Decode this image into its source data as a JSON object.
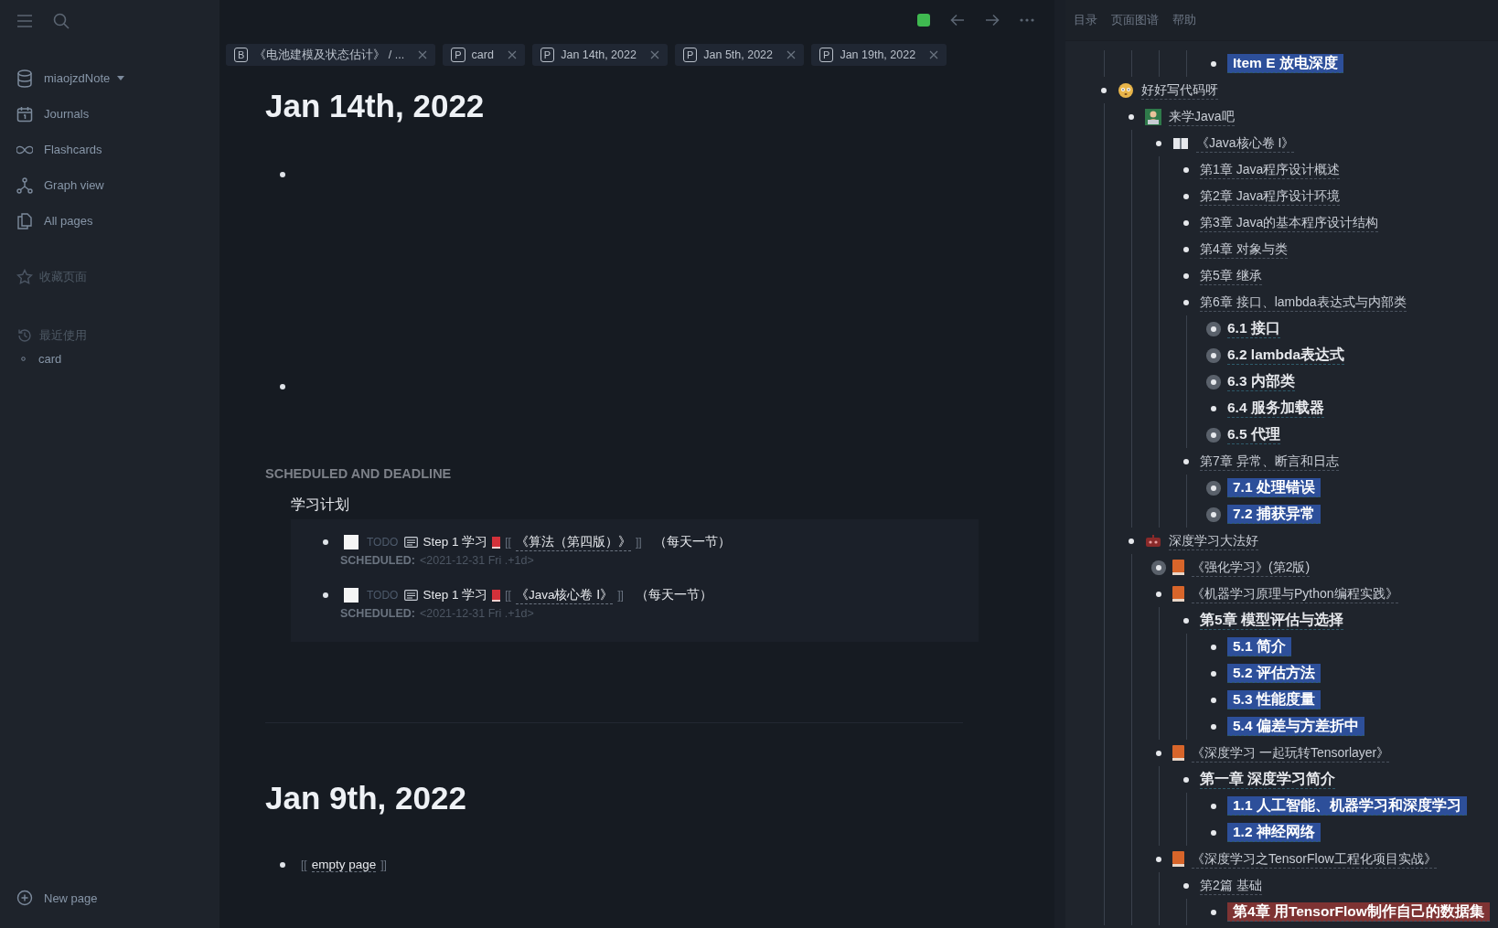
{
  "sidebar": {
    "repo": "miaojzdNote",
    "nav": [
      {
        "label": "Journals",
        "kind": "calendar"
      },
      {
        "label": "Flashcards",
        "kind": "infinity"
      },
      {
        "label": "Graph view",
        "kind": "graph"
      },
      {
        "label": "All pages",
        "kind": "pages"
      }
    ],
    "favorites_heading": "收藏页面",
    "recent_heading": "最近使用",
    "recent": [
      "card"
    ],
    "new_page": "New page"
  },
  "tabs": [
    {
      "badge": "B",
      "label": "《电池建模及状态估计》 / ..."
    },
    {
      "badge": "P",
      "label": "card"
    },
    {
      "badge": "P",
      "label": "Jan 14th, 2022"
    },
    {
      "badge": "P",
      "label": "Jan 5th, 2022"
    },
    {
      "badge": "P",
      "label": "Jan 19th, 2022"
    }
  ],
  "journal": {
    "title": "Jan 14th, 2022",
    "scheduled": {
      "heading": "SCHEDULED AND DEADLINE",
      "group": "学习计划",
      "tasks": [
        {
          "checked": false,
          "marker": "TODO",
          "text": "Step 1 学习",
          "open": "[[",
          "link": "《算法（第四版）》",
          "close": "]]",
          "note": "（每天一节）",
          "label": "SCHEDULED:",
          "value": "<2021-12-31 Fri .+1d>"
        },
        {
          "checked": false,
          "marker": "TODO",
          "text": "Step 1 学习",
          "open": "[[",
          "link": "《Java核心卷 Ⅰ》",
          "close": "]]",
          "note": "（每天一节）",
          "label": "SCHEDULED:",
          "value": "<2021-12-31 Fri .+1d>"
        }
      ]
    }
  },
  "journal_2": {
    "title": "Jan 9th, 2022",
    "open": "[[",
    "link": "empty page",
    "close": "]]"
  },
  "right_panel": {
    "tabs": [
      {
        "label": "目录",
        "selected": false
      },
      {
        "label": "页面图谱",
        "selected": false
      },
      {
        "label": "帮助",
        "selected": false
      }
    ],
    "lead_items": [
      {
        "text": "Item E 放电深度",
        "kind": "blue",
        "collapsed": false
      }
    ],
    "outline": [
      {
        "text": "好好写代码呀",
        "icon": {
          "kind": "face"
        },
        "kind": "plain",
        "collapsed": false,
        "children": [
          {
            "text": "来学Java吧",
            "icon": {
              "kind": "person"
            },
            "kind": "plain",
            "collapsed": false,
            "children": [
              {
                "text": "《Java核心卷 I》",
                "icon": {
                  "kind": "open-book"
                },
                "kind": "plain",
                "collapsed": false,
                "children": [
                  {
                    "text": "第1章 Java程序设计概述",
                    "kind": "plain",
                    "collapsed": false
                  },
                  {
                    "text": "第2章 Java程序设计环境",
                    "kind": "plain",
                    "collapsed": false
                  },
                  {
                    "text": "第3章 Java的基本程序设计结构",
                    "kind": "plain",
                    "collapsed": false
                  },
                  {
                    "text": "第4章 对象与类",
                    "kind": "plain",
                    "collapsed": false
                  },
                  {
                    "text": "第5章 继承",
                    "kind": "plain",
                    "collapsed": false
                  },
                  {
                    "text": "第6章 接口、lambda表达式与内部类",
                    "kind": "plain",
                    "collapsed": false,
                    "children": [
                      {
                        "text": "6.1 接口",
                        "kind": "bold",
                        "collapsed": true
                      },
                      {
                        "text": "6.2 lambda表达式",
                        "kind": "bold",
                        "collapsed": true
                      },
                      {
                        "text": "6.3 内部类",
                        "kind": "bold",
                        "collapsed": true
                      },
                      {
                        "text": "6.4 服务加载器",
                        "kind": "bold",
                        "collapsed": false
                      },
                      {
                        "text": "6.5 代理",
                        "kind": "bold",
                        "collapsed": true
                      }
                    ]
                  },
                  {
                    "text": "第7章 异常、断言和日志",
                    "kind": "plain",
                    "collapsed": false,
                    "children": [
                      {
                        "text": "7.1 处理错误",
                        "kind": "blue",
                        "collapsed": true
                      },
                      {
                        "text": "7.2 捕获异常",
                        "kind": "blue",
                        "collapsed": true
                      }
                    ]
                  }
                ]
              }
            ]
          },
          {
            "text": "深度学习大法好",
            "icon": {
              "kind": "robot"
            },
            "kind": "plain",
            "collapsed": false,
            "children": [
              {
                "text": "《强化学习》(第2版)",
                "icon": {
                  "kind": "book"
                },
                "kind": "plain",
                "collapsed": true
              },
              {
                "text": "《机器学习原理与Python编程实践》",
                "icon": {
                  "kind": "book"
                },
                "kind": "plain",
                "collapsed": false,
                "children": [
                  {
                    "text": "第5章 模型评估与选择",
                    "kind": "bold",
                    "collapsed": false,
                    "children": [
                      {
                        "text": "5.1 简介",
                        "kind": "blue",
                        "collapsed": false
                      },
                      {
                        "text": "5.2 评估方法",
                        "kind": "blue",
                        "collapsed": false
                      },
                      {
                        "text": "5.3 性能度量",
                        "kind": "blue",
                        "collapsed": false
                      },
                      {
                        "text": "5.4 偏差与方差折中",
                        "kind": "blue",
                        "collapsed": false
                      }
                    ]
                  }
                ]
              },
              {
                "text": "《深度学习 一起玩转Tensorlayer》",
                "icon": {
                  "kind": "book"
                },
                "kind": "plain",
                "collapsed": false,
                "children": [
                  {
                    "text": "第一章 深度学习简介",
                    "kind": "bold",
                    "collapsed": false,
                    "children": [
                      {
                        "text": "1.1 人工智能、机器学习和深度学习",
                        "kind": "blue",
                        "collapsed": false
                      },
                      {
                        "text": "1.2 神经网络",
                        "kind": "blue",
                        "collapsed": false
                      }
                    ]
                  }
                ]
              },
              {
                "text": "《深度学习之TensorFlow工程化项目实战》",
                "icon": {
                  "kind": "book"
                },
                "kind": "plain",
                "collapsed": false,
                "children": [
                  {
                    "text": "第2篇 基础",
                    "kind": "plain",
                    "collapsed": false,
                    "children": [
                      {
                        "text": "第4章 用TensorFlow制作自己的数据集",
                        "kind": "red",
                        "collapsed": false
                      }
                    ]
                  }
                ]
              }
            ]
          }
        ]
      }
    ]
  }
}
